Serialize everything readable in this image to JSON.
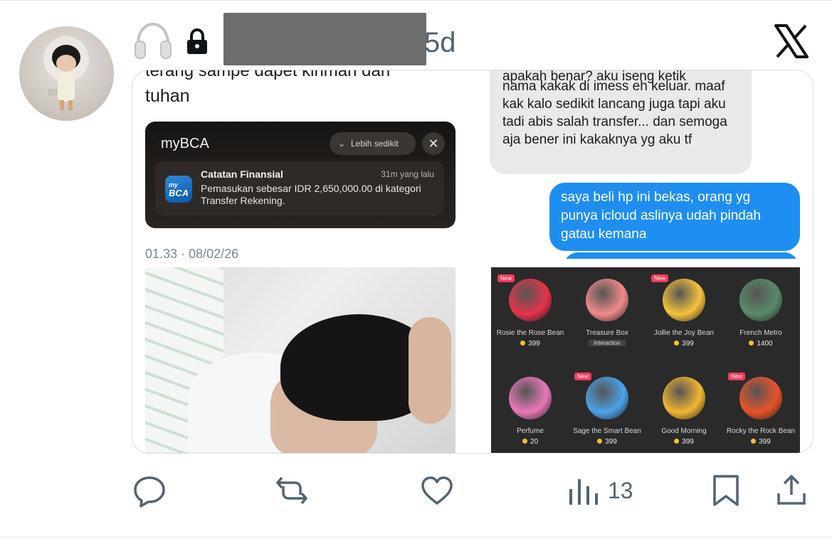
{
  "header": {
    "time_ago": "5d",
    "icons": [
      "headphones-icon",
      "lock-icon",
      "x-logo-icon"
    ]
  },
  "media": {
    "top_left": {
      "cut_text": "terang sampe dapet kiriman dari",
      "tweet_line2": "tuhan",
      "notification": {
        "app_name": "myBCA",
        "pill_label": "Lebih sedikit",
        "close_glyph": "✕",
        "logo_text_top": "my",
        "logo_text_bottom": "BCA",
        "title": "Catatan Finansial",
        "time": "31m yang lalu",
        "body": "Pemasukan sebesar IDR 2,650,000.00 di kategori Transfer Rekening."
      },
      "timestamp": "01.33 · 08/02/26"
    },
    "top_right": {
      "gray_bubble_cut": "apakah benar? aku iseng ketik",
      "gray_bubble_text": "nama kakak di imess eh keluar. maaf kak kalo sedikit lancang juga tapi aku tadi abis salah transfer... dan semoga aja bener ini kakaknya yg aku tf",
      "blue_bubble_text": "saya beli hp ini bekas, orang yg punya icloud aslinya udah pindah gatau kemana"
    },
    "gifts": [
      {
        "name": "Rosie the Rose Bean",
        "price": "399",
        "new": true,
        "color": "#e5344a"
      },
      {
        "name": "Treasure Box",
        "tag": "Interaction",
        "new": false,
        "color": "#f08a8a"
      },
      {
        "name": "Jollie the Joy Bean",
        "price": "399",
        "new": true,
        "color": "#f5c23a"
      },
      {
        "name": "French Metro",
        "price": "1400",
        "new": false,
        "color": "#5a8a6a"
      },
      {
        "name": "Perfume",
        "price": "20",
        "new": false,
        "color": "#e879b6"
      },
      {
        "name": "Sage the Smart Bean",
        "price": "399",
        "new": true,
        "color": "#4aa3e8"
      },
      {
        "name": "Good Morning",
        "price": "399",
        "new": false,
        "color": "#f2b531"
      },
      {
        "name": "Rocky the Rock Bean",
        "price": "399",
        "new": true,
        "color": "#e8532a"
      }
    ],
    "new_label": "New"
  },
  "actions": {
    "reply": "reply-icon",
    "repost": "repost-icon",
    "like": "like-icon",
    "views": "13",
    "bookmark": "bookmark-icon",
    "share": "share-icon"
  }
}
